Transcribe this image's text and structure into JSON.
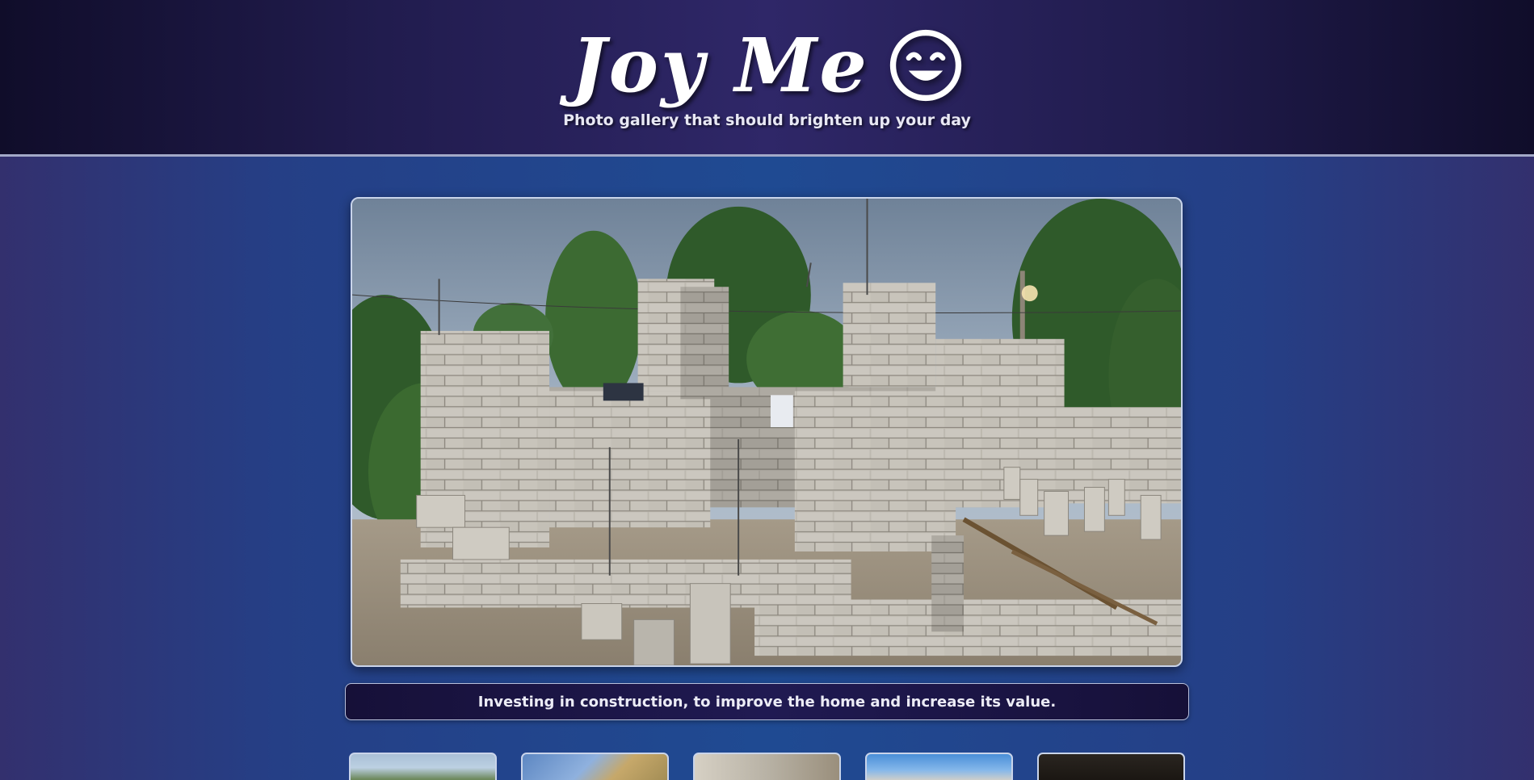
{
  "header": {
    "title": "Joy Me",
    "title_icon": "smiley-face-icon",
    "tagline": "Photo gallery that should brighten up your day"
  },
  "viewer": {
    "image_alt": "Concrete block house walls under construction"
  },
  "caption": {
    "text": "Investing in construction, to improve the home and increase its value."
  },
  "thumbnails": [
    {
      "alt": "thumbnail 1"
    },
    {
      "alt": "thumbnail 2"
    },
    {
      "alt": "thumbnail 3"
    },
    {
      "alt": "thumbnail 4"
    },
    {
      "alt": "thumbnail 5"
    }
  ],
  "colors": {
    "header_bg": "#211c4e",
    "page_bg": "#1f4a92",
    "caption_bg": "#161038",
    "frame_border": "#c9d4ea"
  }
}
